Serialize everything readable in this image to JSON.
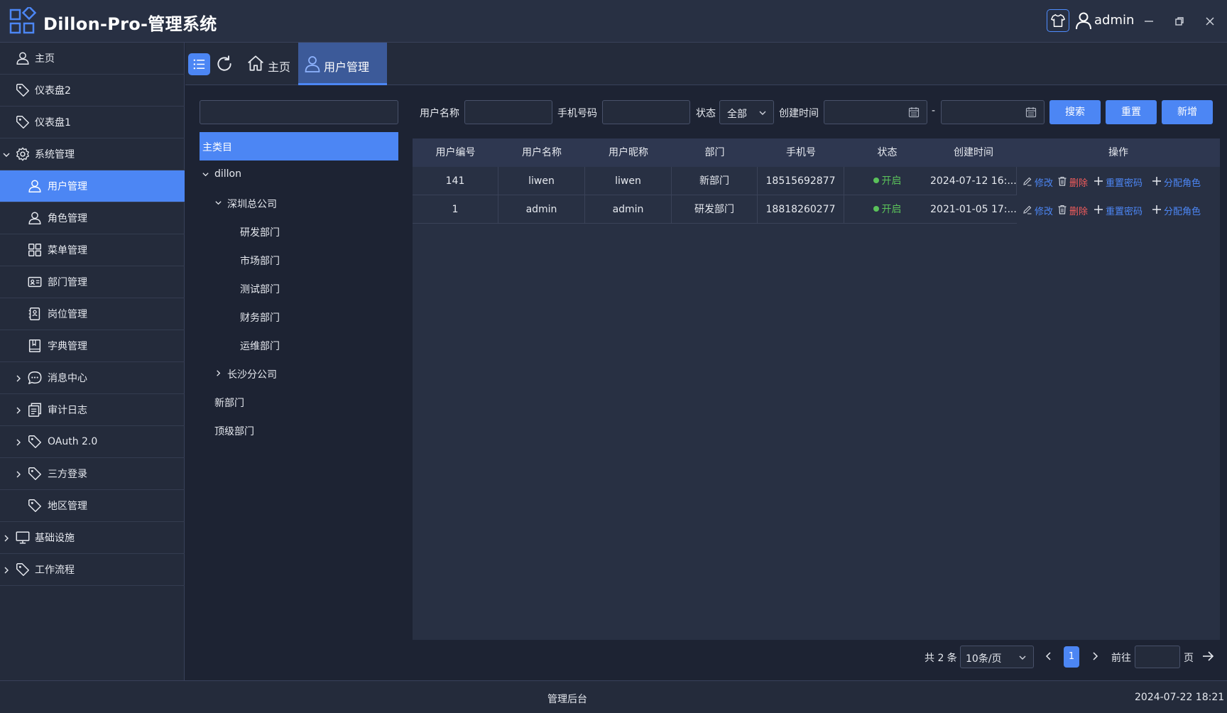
{
  "app": {
    "title": "Dillon-Pro-管理系统",
    "user": "admin",
    "accent": "#4c86f4"
  },
  "sidebar": {
    "items": [
      {
        "label": "主页",
        "icon": "user-icon"
      },
      {
        "label": "仪表盘2",
        "icon": "tag-icon"
      },
      {
        "label": "仪表盘1",
        "icon": "tag-icon"
      },
      {
        "label": "系统管理",
        "icon": "gear-icon",
        "expanded": true
      },
      {
        "label": "用户管理",
        "icon": "user-icon",
        "active": true
      },
      {
        "label": "角色管理",
        "icon": "user-icon"
      },
      {
        "label": "菜单管理",
        "icon": "grid-icon"
      },
      {
        "label": "部门管理",
        "icon": "id-card-icon"
      },
      {
        "label": "岗位管理",
        "icon": "badge-icon"
      },
      {
        "label": "字典管理",
        "icon": "book-icon"
      },
      {
        "label": "消息中心",
        "icon": "chat-icon"
      },
      {
        "label": "审计日志",
        "icon": "document-icon"
      },
      {
        "label": "OAuth 2.0",
        "icon": "tag-icon"
      },
      {
        "label": "三方登录",
        "icon": "tag-icon"
      },
      {
        "label": "地区管理",
        "icon": "tag-icon"
      },
      {
        "label": "基础设施",
        "icon": "monitor-icon"
      },
      {
        "label": "工作流程",
        "icon": "tag-icon"
      }
    ]
  },
  "tabs": {
    "home": "主页",
    "user": "用户管理"
  },
  "tree": {
    "search_placeholder": "",
    "root": "主类目",
    "nodes": [
      "dillon",
      "深圳总公司",
      "研发部门",
      "市场部门",
      "测试部门",
      "财务部门",
      "运维部门",
      "长沙分公司",
      "新部门",
      "顶级部门"
    ]
  },
  "filters": {
    "username_label": "用户名称",
    "username_value": "",
    "phone_label": "手机号码",
    "phone_value": "",
    "status_label": "状态",
    "status_value": "全部",
    "created_label": "创建时间",
    "date_sep": "-",
    "search": "搜索",
    "reset": "重置",
    "add": "新增"
  },
  "table": {
    "columns": [
      "用户编号",
      "用户名称",
      "用户昵称",
      "部门",
      "手机号",
      "状态",
      "创建时间",
      "操作"
    ],
    "rows": [
      {
        "id": "141",
        "username": "liwen",
        "nickname": "liwen",
        "dept": "新部门",
        "phone": "18515692877",
        "status": "开启",
        "created": "2024-07-12 16:..."
      },
      {
        "id": "1",
        "username": "admin",
        "nickname": "admin",
        "dept": "研发部门",
        "phone": "18818260277",
        "status": "开启",
        "created": "2021-01-05 17:..."
      }
    ],
    "actions": {
      "edit": "修改",
      "delete": "删除",
      "reset_pwd": "重置密码",
      "assign_role": "分配角色"
    },
    "status_color": "#5ac15a",
    "delete_color": "#f25c5c"
  },
  "pagination": {
    "total": "共 2 条",
    "page_size": "10条/页",
    "current": "1",
    "goto_label": "前往",
    "goto_value": "",
    "page_label": "页"
  },
  "footer": {
    "center": "管理后台",
    "time": "2024-07-22 18:21"
  }
}
